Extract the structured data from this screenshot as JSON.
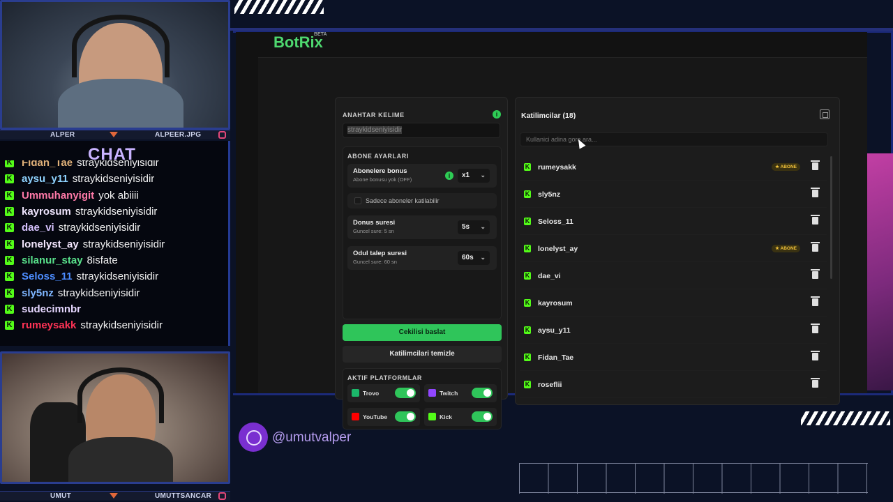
{
  "cams": {
    "top": {
      "left_name": "ALPER",
      "right_name": "ALPEER.JPG"
    },
    "bottom": {
      "left_name": "UMUT",
      "right_name": "UMUTTSANCAR"
    }
  },
  "chat": {
    "title": "CHAT",
    "messages": [
      {
        "user": "Fidan_Tae",
        "text": "straykidseniyisidir",
        "color": "#e2b27a"
      },
      {
        "user": "aysu_y11",
        "text": "straykidseniyisidir",
        "color": "#8fd3ff"
      },
      {
        "user": "Ummuhanyigit",
        "text": "yok abiiii",
        "color": "#ff7aa8"
      },
      {
        "user": "kayrosum",
        "text": "straykidseniyisidir",
        "color": "#f0e6ff"
      },
      {
        "user": "dae_vi",
        "text": "straykidseniyisidir",
        "color": "#d8c4ff"
      },
      {
        "user": "lonelyst_ay",
        "text": "straykidseniyisidir",
        "color": "#f5e8ff"
      },
      {
        "user": "silanur_stay",
        "text": "8isfate",
        "color": "#58e08a"
      },
      {
        "user": "Seloss_11",
        "text": "straykidseniyisidir",
        "color": "#4d8dff"
      },
      {
        "user": "sly5nz",
        "text": "straykidseniyisidir",
        "color": "#7fb6ff"
      },
      {
        "user": "sudecimnbr",
        "text": "",
        "color": "#e6d7ff"
      },
      {
        "user": "rumeysakk",
        "text": "straykidseniyisidir",
        "color": "#ff3355"
      }
    ]
  },
  "app": {
    "brand": "BotRix",
    "brand_badge": "BETA",
    "keyword": {
      "label": "ANAHTAR KELIME",
      "value": "straykidseniyisidir"
    },
    "sub_settings": {
      "label": "ABONE AYARLARI",
      "bonus_title": "Abonelere bonus",
      "bonus_sub": "Abone bonusu yok (OFF)",
      "bonus_value": "x1",
      "only_subs_label": "Sadece aboneler katilabilir",
      "duration_title": "Donus suresi",
      "duration_sub": "Guncel sure: 5 sn",
      "duration_value": "5s",
      "claim_title": "Odul talep suresi",
      "claim_sub": "Guncel sure: 60 sn",
      "claim_value": "60s"
    },
    "start_button": "Cekilisi baslat",
    "clear_button": "Katilimcilari temizle",
    "platforms": {
      "label": "AKTIF PLATFORMLAR",
      "items": [
        {
          "name": "Trovo",
          "on": true,
          "color": "#1bb86a"
        },
        {
          "name": "Twitch",
          "on": true,
          "color": "#9146ff"
        },
        {
          "name": "YouTube",
          "on": true,
          "color": "#ff0000"
        },
        {
          "name": "Kick",
          "on": true,
          "color": "#53fc18"
        }
      ]
    },
    "participants": {
      "title": "Katilimcilar (18)",
      "search_placeholder": "Kullanici adina gore ara...",
      "subscriber_badge": "ABONE",
      "rows": [
        {
          "name": "rumeysakk",
          "subscriber": true
        },
        {
          "name": "sly5nz",
          "subscriber": false
        },
        {
          "name": "Seloss_11",
          "subscriber": false
        },
        {
          "name": "lonelyst_ay",
          "subscriber": true
        },
        {
          "name": "dae_vi",
          "subscriber": false
        },
        {
          "name": "kayrosum",
          "subscriber": false
        },
        {
          "name": "aysu_y11",
          "subscriber": false
        },
        {
          "name": "Fidan_Tae",
          "subscriber": false
        },
        {
          "name": "roseflii",
          "subscriber": false
        }
      ]
    }
  },
  "social": {
    "handle": "@umutvalper"
  },
  "colors": {
    "accent_green": "#2fc55a",
    "kick_green": "#53fc18",
    "frame_blue": "#2a3d8f",
    "social_purple": "#7a2fd0"
  }
}
